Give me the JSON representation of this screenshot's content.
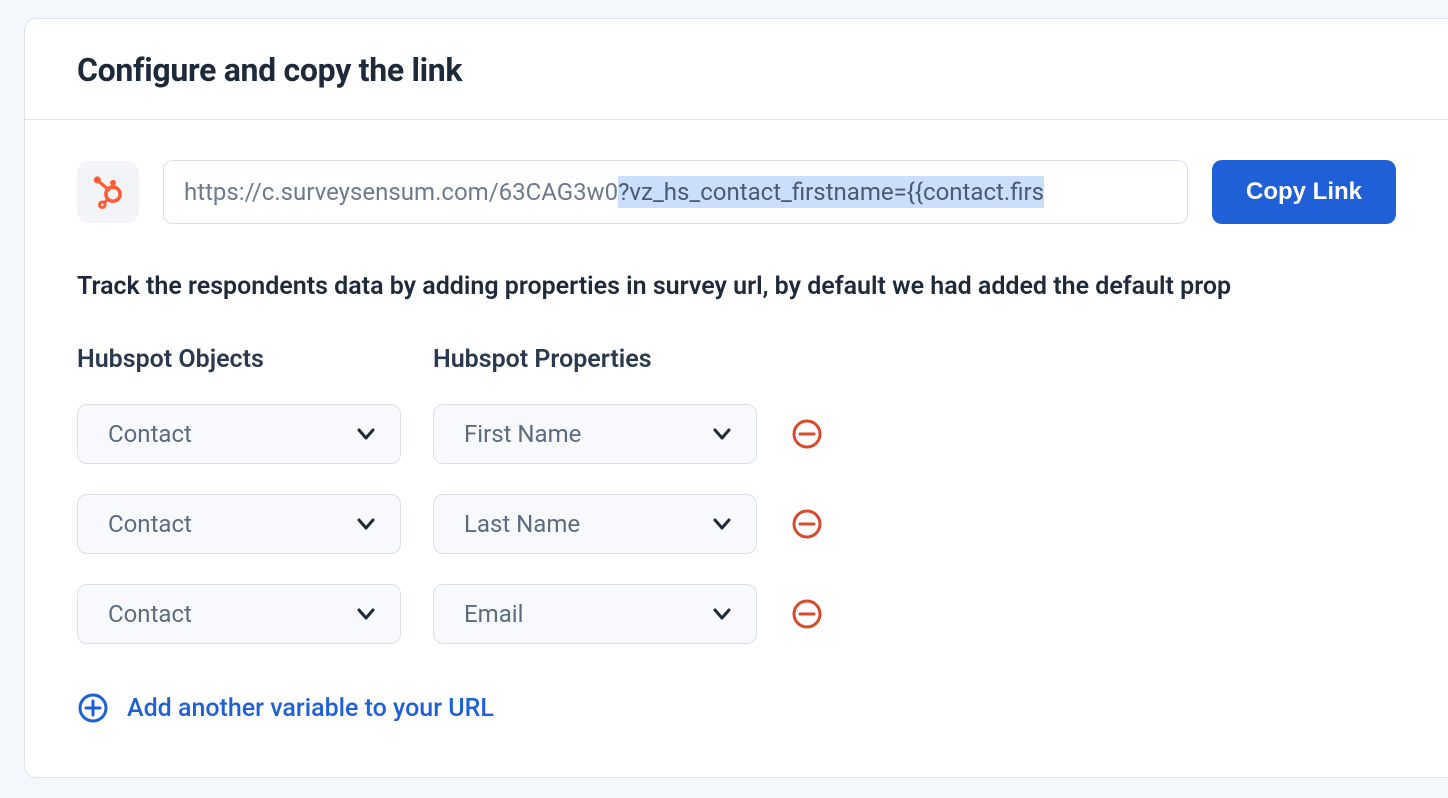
{
  "header": {
    "title": "Configure and copy the link"
  },
  "link_row": {
    "icon": "hubspot-icon",
    "url_plain": "https://c.surveysensum.com/63CAG3w0",
    "url_highlight": "?vz_hs_contact_firstname={{contact.firs",
    "copy_label": "Copy Link"
  },
  "description": "Track the respondents data by adding properties in survey url, by default we had added the default prop",
  "table": {
    "objects_header": "Hubspot Objects",
    "properties_header": "Hubspot Properties",
    "rows": [
      {
        "object": "Contact",
        "property": "First Name"
      },
      {
        "object": "Contact",
        "property": "Last Name"
      },
      {
        "object": "Contact",
        "property": "Email"
      }
    ]
  },
  "add_variable_label": "Add another variable to your URL"
}
